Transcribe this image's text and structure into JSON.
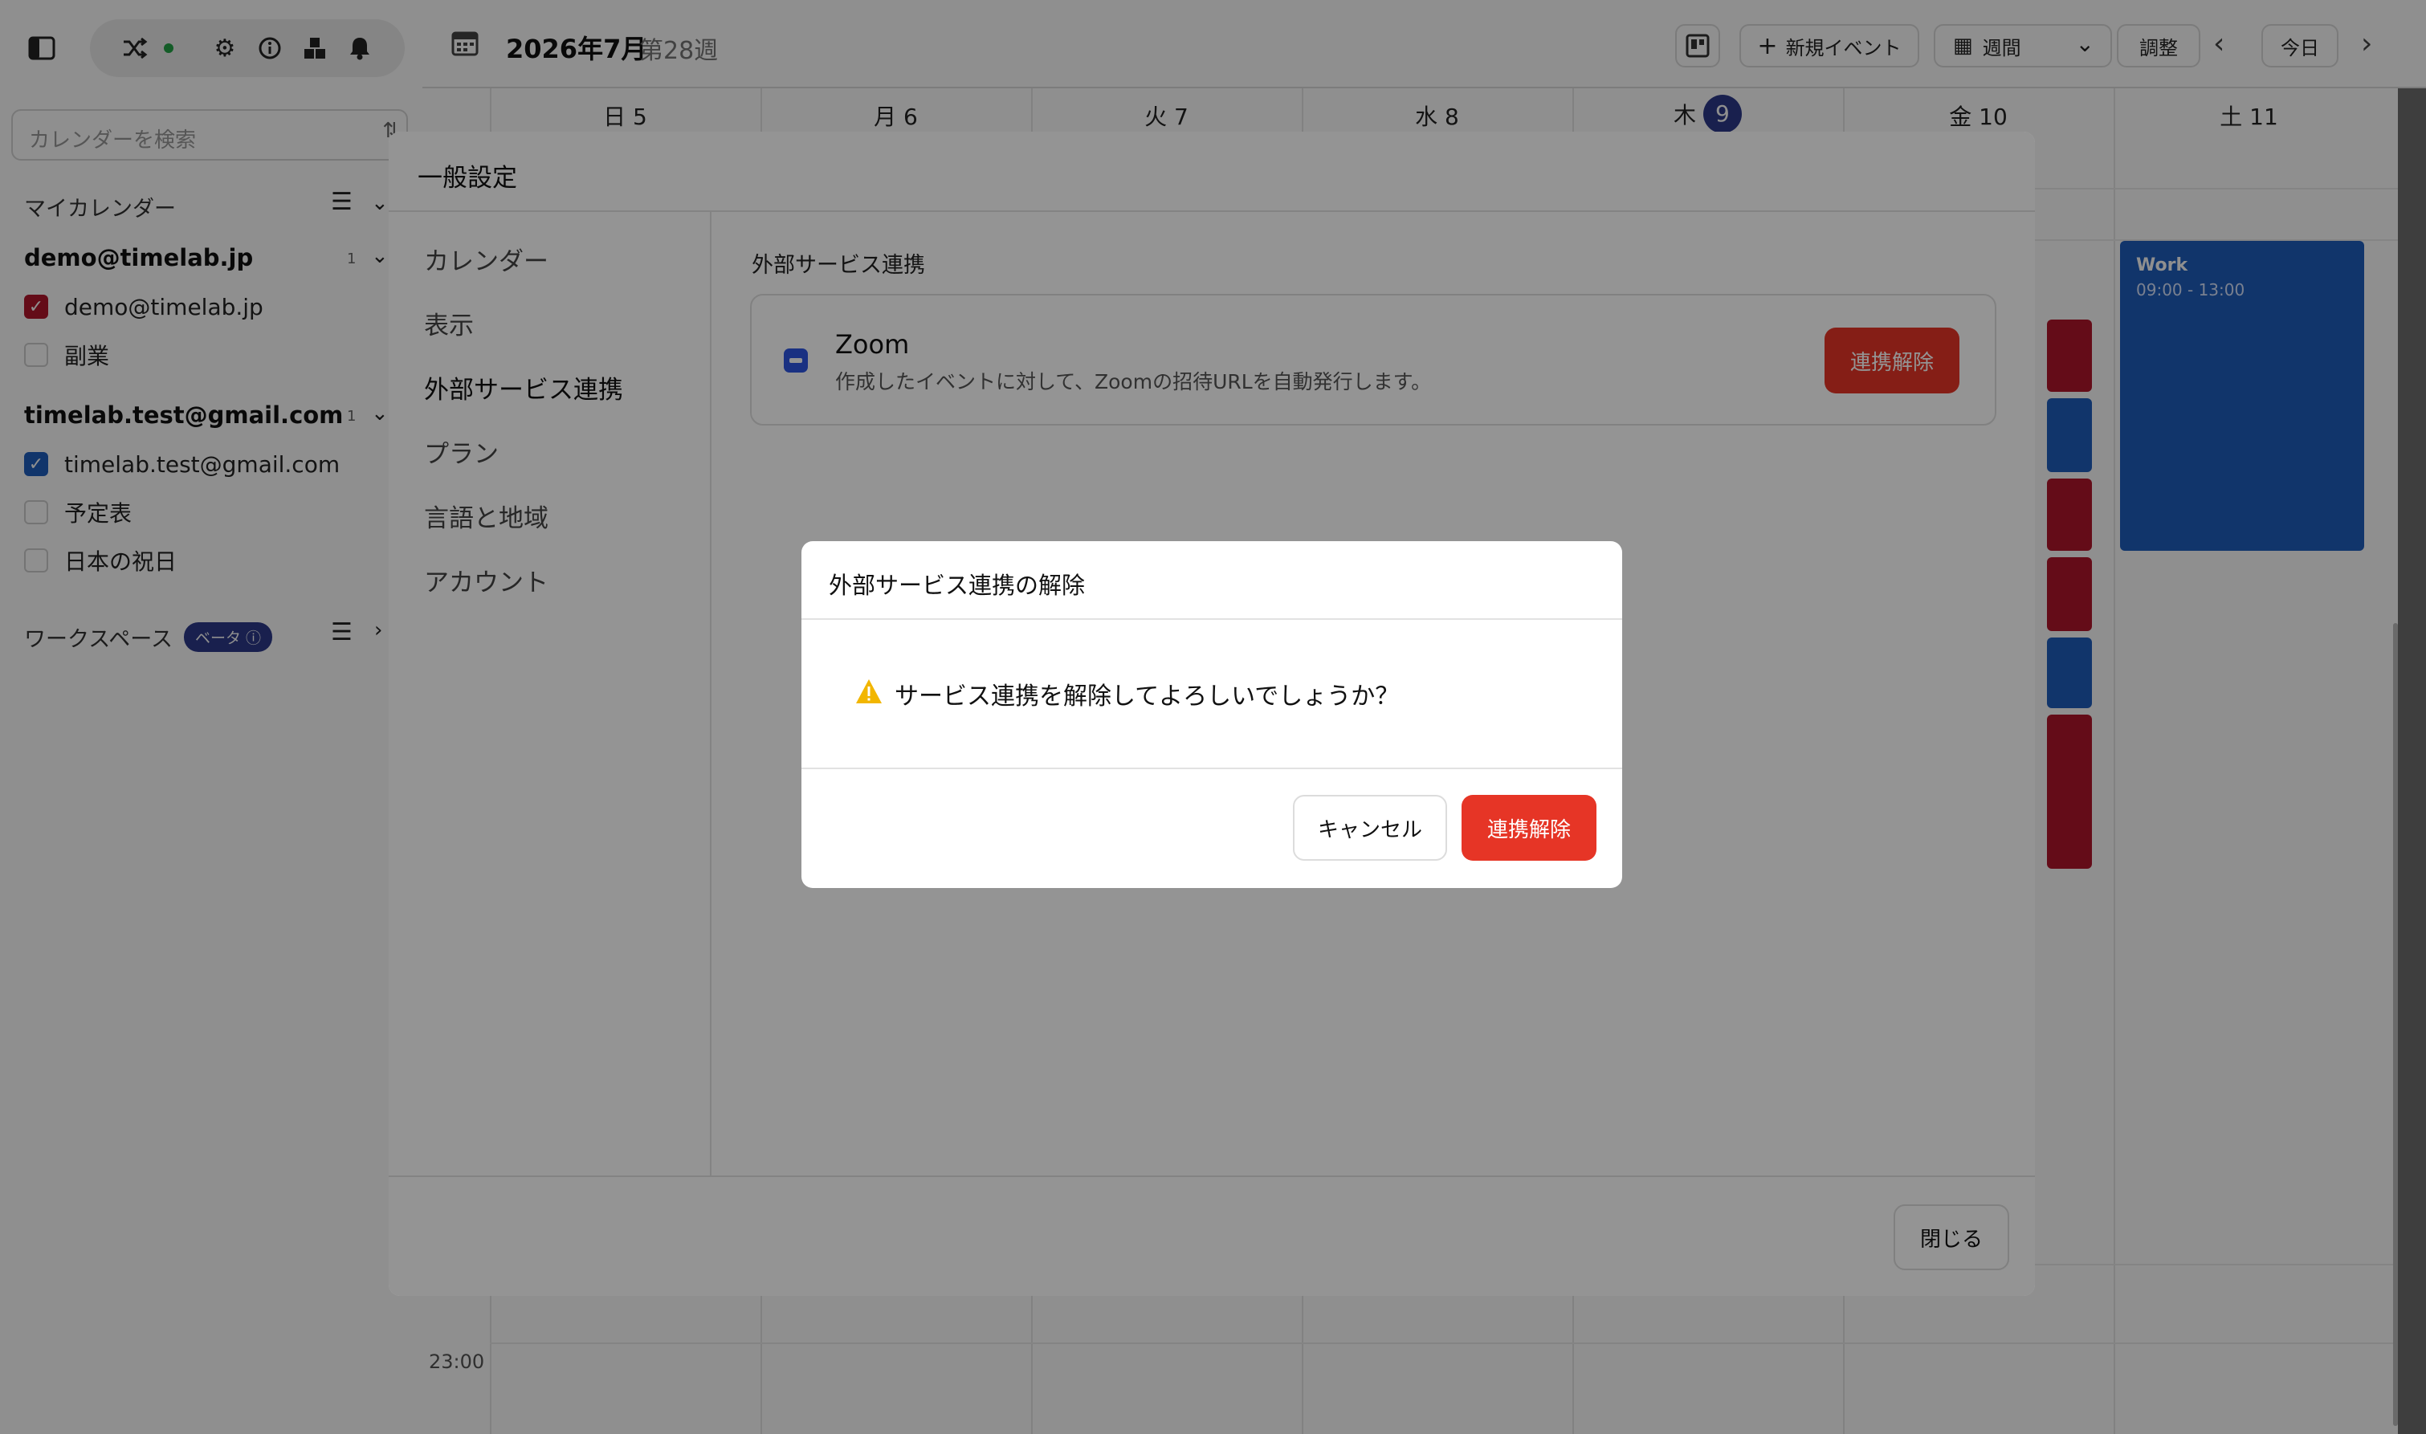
{
  "sidebar": {
    "search_placeholder": "カレンダーを検索",
    "my_calendars_title": "マイカレンダー",
    "accounts": [
      {
        "email": "demo@timelab.jp",
        "count": "1",
        "calendars": [
          {
            "label": "demo@timelab.jp",
            "checked": true,
            "color": "#b3172c"
          },
          {
            "label": "副業",
            "checked": false
          }
        ]
      },
      {
        "email": "timelab.test@gmail.com",
        "count": "1",
        "calendars": [
          {
            "label": "timelab.test@gmail.com",
            "checked": true,
            "color": "#1f5fbf"
          },
          {
            "label": "予定表",
            "checked": false
          },
          {
            "label": "日本の祝日",
            "checked": false
          }
        ]
      }
    ],
    "workspace_title": "ワークスペース",
    "workspace_badge": "ベータ",
    "icons": [
      "sidebar-toggle-icon",
      "shuffle-icon",
      "gear-icon",
      "info-icon",
      "grid-icon",
      "bell-icon"
    ]
  },
  "topbar": {
    "month": "2026年7月",
    "week": "第28週",
    "new_event": "新規イベント",
    "view": "週間",
    "adjust": "調整",
    "today": "今日"
  },
  "calendar": {
    "days": [
      {
        "dow": "日",
        "date": "5"
      },
      {
        "dow": "月",
        "date": "6"
      },
      {
        "dow": "火",
        "date": "7"
      },
      {
        "dow": "水",
        "date": "8"
      },
      {
        "dow": "木",
        "date": "9",
        "today": true
      },
      {
        "dow": "金",
        "date": "10"
      },
      {
        "dow": "土",
        "date": "11"
      }
    ],
    "time_label": "23:00",
    "event": {
      "title": "Work",
      "time": "09:00 - 13:00"
    },
    "colors": {
      "red": "#b3172c",
      "blue": "#1f5fbf",
      "today": "#2d3a8c"
    }
  },
  "settings": {
    "title": "一般設定",
    "nav": [
      "カレンダー",
      "表示",
      "外部サービス連携",
      "プラン",
      "言語と地域",
      "アカウント"
    ],
    "active_nav": "外部サービス連携",
    "section_title": "外部サービス連携",
    "integration": {
      "name": "Zoom",
      "description": "作成したイベントに対して、Zoomの招待URLを自動発行します。",
      "button": "連携解除"
    },
    "close": "閉じる"
  },
  "confirm_dialog": {
    "title": "外部サービス連携の解除",
    "message": "サービス連携を解除してよろしいでしょうか？",
    "cancel": "キャンセル",
    "confirm": "連携解除",
    "accent": "#e63526",
    "warning_color": "#f2b600"
  }
}
